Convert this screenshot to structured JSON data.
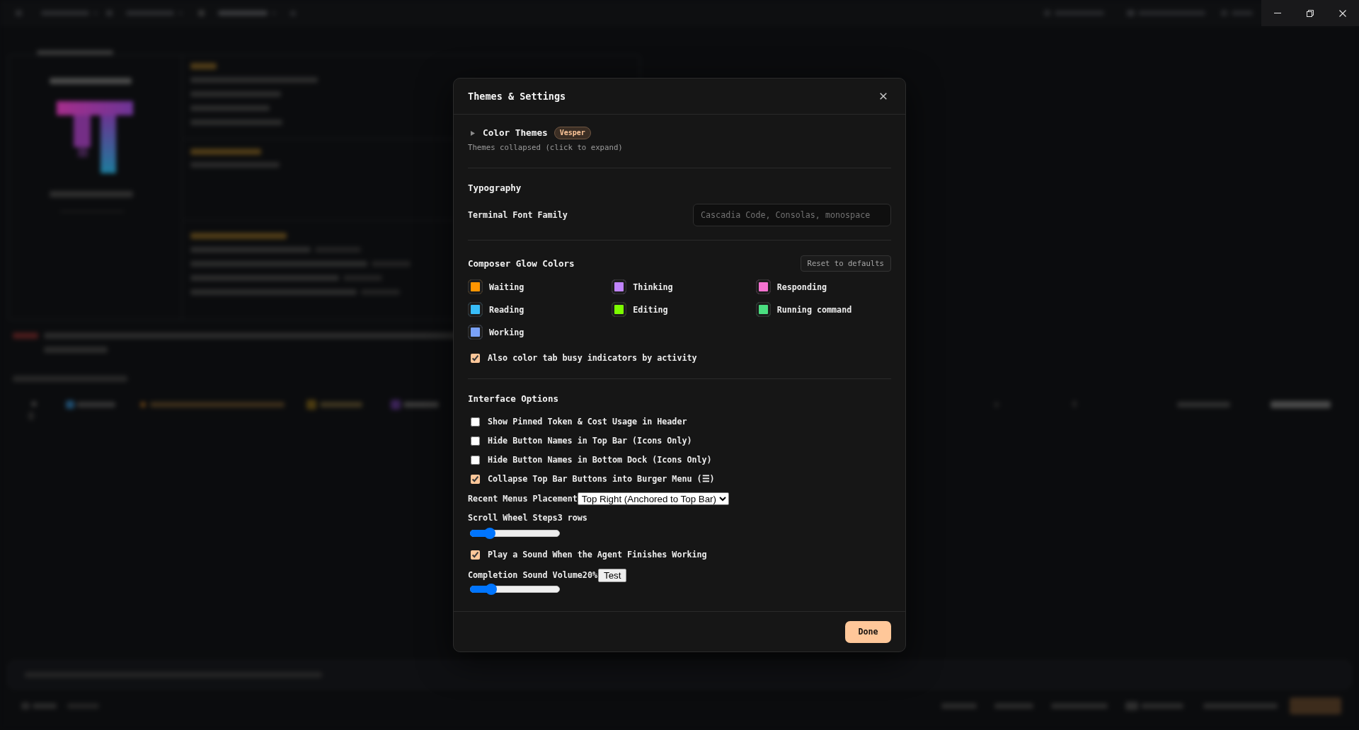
{
  "window_controls": [
    {
      "kind": "minimize"
    },
    {
      "kind": "restore"
    },
    {
      "kind": "close"
    }
  ],
  "dialog": {
    "title": "Themes & Settings",
    "color_themes": {
      "title": "Color Themes",
      "expanded": false,
      "badge": "Vesper",
      "hint": "Themes collapsed (click to expand)"
    },
    "typography": {
      "title": "Typography",
      "fields": [
        {
          "label": "Terminal Font Family",
          "placeholder": "Cascadia Code, Consolas, monospace"
        }
      ]
    },
    "glow_colors": {
      "title": "Composer Glow Colors",
      "reset_button": "Reset to defaults",
      "colors": [
        {
          "label": "Waiting",
          "color": "#ff9500"
        },
        {
          "label": "Thinking",
          "color": "#c084fc"
        },
        {
          "label": "Responding",
          "color": "#f472d0"
        },
        {
          "label": "Reading",
          "color": "#38bdf8"
        },
        {
          "label": "Editing",
          "color": "#7cfc00"
        },
        {
          "label": "Running command",
          "color": "#4ade80"
        },
        {
          "label": "Working",
          "color": "#7aa2f7"
        }
      ],
      "extra_option": {
        "label": "Also color tab busy indicators by activity",
        "checked": true
      }
    },
    "interface_options": {
      "title": "Interface Options",
      "items": [
        {
          "kind": "checkbox",
          "label": "Show Pinned Token & Cost Usage in Header",
          "checked": false
        },
        {
          "kind": "checkbox",
          "label": "Hide Button Names in Top Bar (Icons Only)",
          "checked": false
        },
        {
          "kind": "checkbox",
          "label": "Hide Button Names in Bottom Dock (Icons Only)",
          "checked": false
        },
        {
          "kind": "checkbox",
          "label": "Collapse Top Bar Buttons into Burger Menu (☰)",
          "checked": true
        },
        {
          "kind": "select",
          "label": "Recent Menus Placement",
          "value": "Top Right (Anchored to Top Bar)"
        },
        {
          "kind": "slider",
          "label": "Scroll Wheel Steps",
          "reading": "3 rows",
          "level": 0.18
        },
        {
          "kind": "checkbox",
          "label": "Play a Sound When the Agent Finishes Working",
          "checked": true
        },
        {
          "kind": "slider",
          "label": "Completion Sound Volume",
          "reading": "20%",
          "level": 0.2,
          "button": "Test"
        }
      ]
    },
    "done_button": "Done"
  }
}
